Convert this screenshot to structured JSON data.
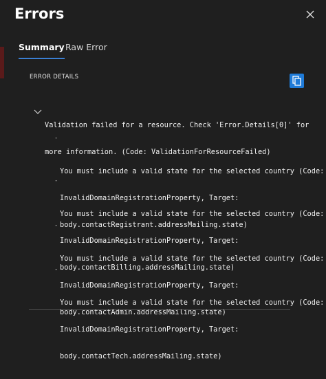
{
  "dialog": {
    "title": "Errors"
  },
  "tabs": [
    {
      "label": "Summary",
      "active": true
    },
    {
      "label": "Raw Error",
      "active": false
    }
  ],
  "section_label": "ERROR DETAILS",
  "main_message": {
    "line1": "Validation failed for a resource. Check 'Error.Details[0]' for",
    "line2": "more information. (Code: ValidationForResourceFailed)"
  },
  "details": [
    {
      "bullet": "-",
      "line1": "You must include a valid state for the selected country (Code:",
      "line2": "InvalidDomainRegistrationProperty, Target:",
      "line3": "body.contactRegistrant.addressMailing.state)"
    },
    {
      "bullet": "-",
      "line1": "You must include a valid state for the selected country (Code:",
      "line2": "InvalidDomainRegistrationProperty, Target:",
      "line3": "body.contactBilling.addressMailing.state)"
    },
    {
      "bullet": "-",
      "line1": "You must include a valid state for the selected country (Code:",
      "line2": "InvalidDomainRegistrationProperty, Target:",
      "line3": "body.contactAdmin.addressMailing.state)"
    },
    {
      "bullet": "-",
      "line1": "You must include a valid state for the selected country (Code:",
      "line2": "InvalidDomainRegistrationProperty, Target:",
      "line3": "body.contactTech.addressMailing.state)"
    }
  ],
  "icons": {
    "close": "close-icon",
    "copy": "copy-icon",
    "expand": "chevron-down-icon"
  },
  "colors": {
    "background": "#1f1f1f",
    "accent": "#1f7bd8",
    "tab_underline": "#3a7fd3"
  }
}
